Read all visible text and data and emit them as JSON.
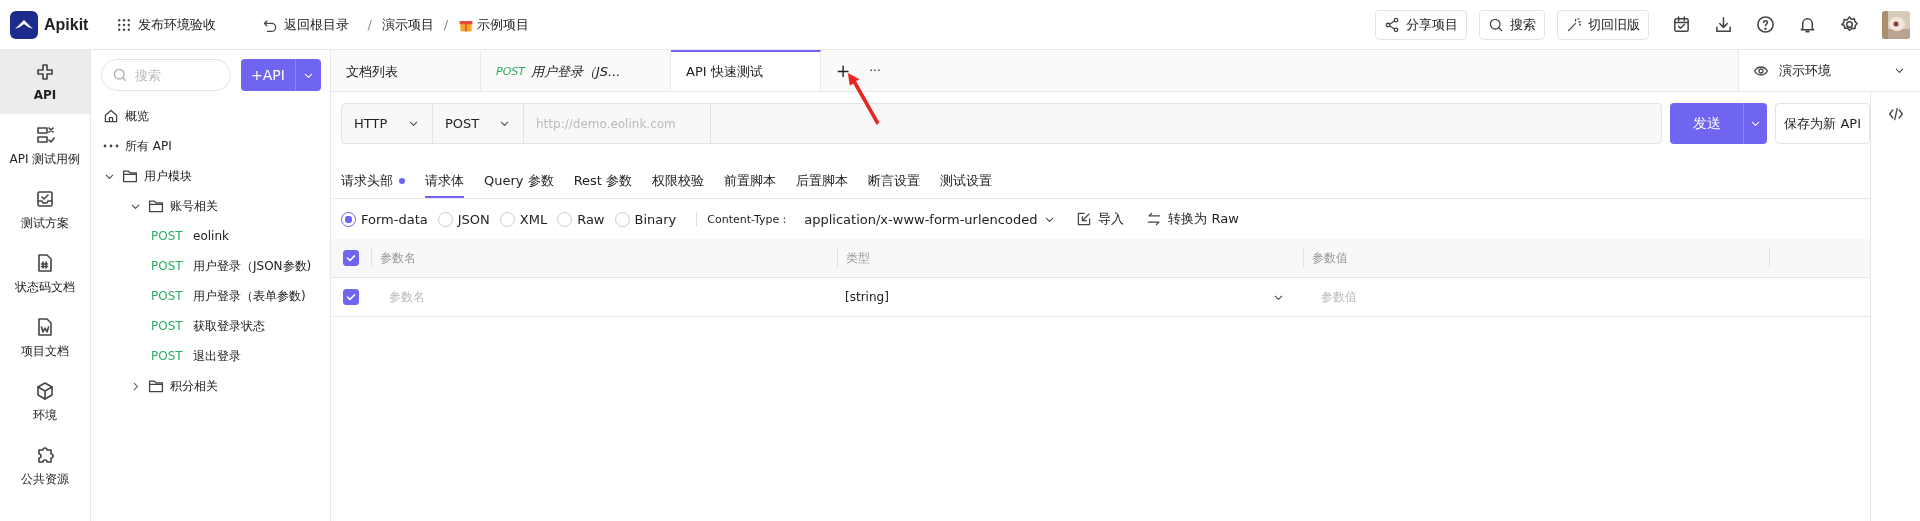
{
  "header": {
    "logo": "Apikit",
    "workspace": "发布环境验收",
    "back": "返回根目录",
    "separator": "/",
    "breadcrumb": [
      "演示项目",
      "示例项目"
    ],
    "buttons": [
      {
        "label": "分享项目",
        "kind": "share"
      },
      {
        "label": "搜索",
        "kind": "search"
      },
      {
        "label": "切回旧版",
        "kind": "wand"
      }
    ]
  },
  "nav": [
    {
      "label": "API",
      "kind": "api",
      "selected": true
    },
    {
      "label": "API 测试用例",
      "kind": "cases",
      "selected": false
    },
    {
      "label": "测试方案",
      "kind": "plan",
      "selected": false
    },
    {
      "label": "状态码文档",
      "kind": "code",
      "selected": false
    },
    {
      "label": "项目文档",
      "kind": "doc",
      "selected": false
    },
    {
      "label": "环境",
      "kind": "env",
      "selected": false
    },
    {
      "label": "公共资源",
      "kind": "puzzle",
      "selected": false
    }
  ],
  "tree": {
    "search": {
      "placeholder": "搜索"
    },
    "add_button": "+API",
    "items": [
      {
        "label": "概览",
        "kind": "home"
      },
      {
        "label": "所有 API",
        "kind": "all"
      },
      {
        "label": "用户模块",
        "kind": "folder",
        "expanded": true,
        "children": [
          {
            "label": "账号相关",
            "kind": "folder",
            "expanded": true,
            "children": [
              {
                "kind": "endpoint",
                "method": "POST",
                "label": "eolink"
              },
              {
                "kind": "endpoint",
                "method": "POST",
                "label": "用户登录（JSON参数)"
              },
              {
                "kind": "endpoint",
                "method": "POST",
                "label": "用户登录（表单参数)"
              },
              {
                "kind": "endpoint",
                "method": "POST",
                "label": "获取登录状态"
              },
              {
                "kind": "endpoint",
                "method": "POST",
                "label": "退出登录"
              }
            ]
          },
          {
            "label": "积分相关",
            "kind": "folder",
            "expanded": false
          }
        ]
      }
    ]
  },
  "tabs": [
    {
      "label": "文档列表",
      "selected": false
    },
    {
      "method": "POST",
      "label": "用户登录（JS...",
      "selected": false
    },
    {
      "label": "API 快速测试",
      "selected": true
    }
  ],
  "tab_actions": {
    "add": "+",
    "more": "···"
  },
  "environment": "演示环境",
  "request": {
    "protocol": "HTTP",
    "method": "POST",
    "url": {
      "placeholder": "http://demo.eolink.com"
    },
    "send": "发送",
    "save": "保存为新 API"
  },
  "request_tabs": [
    {
      "label": "请求头部",
      "selected": false,
      "dot": true
    },
    {
      "label": "请求体",
      "selected": true,
      "dot": false
    },
    {
      "label": "Query 参数",
      "selected": false,
      "dot": false
    },
    {
      "label": "Rest 参数",
      "selected": false,
      "dot": false
    },
    {
      "label": "权限校验",
      "selected": false,
      "dot": false
    },
    {
      "label": "前置脚本",
      "selected": false,
      "dot": false
    },
    {
      "label": "后置脚本",
      "selected": false,
      "dot": false
    },
    {
      "label": "断言设置",
      "selected": false,
      "dot": false
    },
    {
      "label": "测试设置",
      "selected": false,
      "dot": false
    }
  ],
  "body_types": [
    {
      "label": "Form-data",
      "selected": true
    },
    {
      "label": "JSON",
      "selected": false
    },
    {
      "label": "XML",
      "selected": false
    },
    {
      "label": "Raw",
      "selected": false
    },
    {
      "label": "Binary",
      "selected": false
    }
  ],
  "content_type": {
    "label": "Content-Type：",
    "value": "application/x-www-form-urlencoded"
  },
  "body_actions": [
    {
      "label": "导入",
      "kind": "import"
    },
    {
      "label": "转换为 Raw",
      "kind": "convert"
    }
  ],
  "table": {
    "all_checked": true,
    "columns": [
      "参数名",
      "类型",
      "参数值"
    ],
    "rows": [
      {
        "checked": true,
        "name": {
          "placeholder": "参数名"
        },
        "type": "[string]",
        "value": {
          "placeholder": "参数值"
        }
      }
    ]
  }
}
